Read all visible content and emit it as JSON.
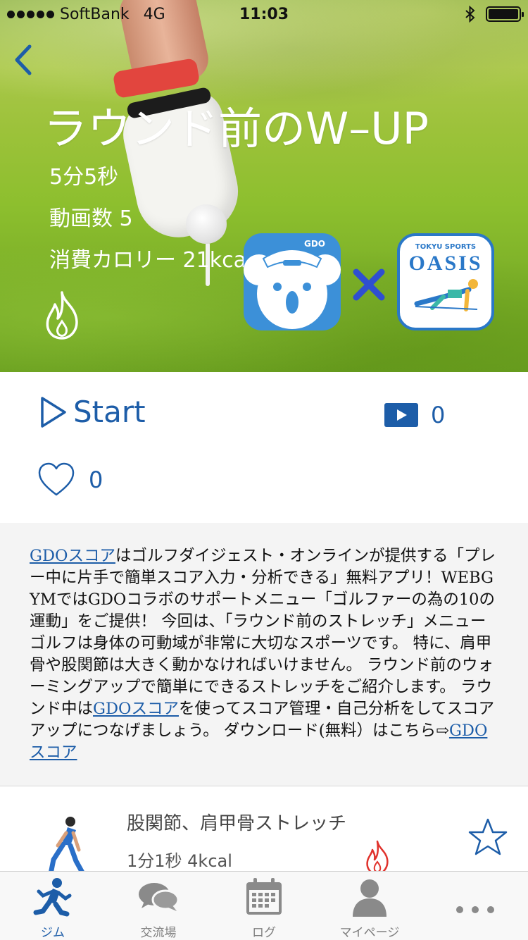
{
  "status_bar": {
    "carrier": "SoftBank",
    "network": "4G",
    "time": "11:03"
  },
  "hero": {
    "title": "ラウンド前のW–UP",
    "duration": "5分5秒",
    "video_count": "動画数  5",
    "calorie": "消費カロリー 21kcal",
    "partner_left_label": "GDO",
    "partner_right_label_top": "TOKYU SPORTS",
    "partner_right_label_main": "OASIS"
  },
  "actions": {
    "start_label": "Start",
    "video_views": "0",
    "likes": "0"
  },
  "description": {
    "link1": "GDOスコア",
    "text1": "はゴルフダイジェスト・オンラインが提供する「プレー中に片手で簡単スコア入力・分析できる」無料アプリ！WEBGYMではGDOコラボのサポートメニュー「ゴルファーの為の10の運動」をご提供！ 今回は、「ラウンド前のストレッチ」メニュー ゴルフは身体の可動域が非常に大切なスポーツです。 特に、肩甲骨や股関節は大きく動かなければいけません。 ラウンド前のウォーミングアップで簡単にできるストレッチをご紹介します。 ラウンド中は",
    "link2": "GDOスコア",
    "text2": "を使ってスコア管理・自己分析をしてスコアアップにつなげましょう。 ダウンロード(無料）はこちら⇨",
    "link3": "GDOスコア"
  },
  "menu_items": [
    {
      "title": "股関節、肩甲骨ストレッチ",
      "meta": "1分1秒  4kcal"
    }
  ],
  "tabbar": {
    "tabs": [
      {
        "label": "ジム",
        "icon": "runner-icon",
        "active": true
      },
      {
        "label": "交流場",
        "icon": "chat-bubbles-icon",
        "active": false
      },
      {
        "label": "ログ",
        "icon": "calendar-icon",
        "active": false
      },
      {
        "label": "マイページ",
        "icon": "person-icon",
        "active": false
      },
      {
        "label": "",
        "icon": "more-dots-icon",
        "active": false
      }
    ]
  },
  "colors": {
    "accent": "#1d5da8",
    "flame": "#e0322c",
    "gdo_icon": "#3c90d8"
  }
}
